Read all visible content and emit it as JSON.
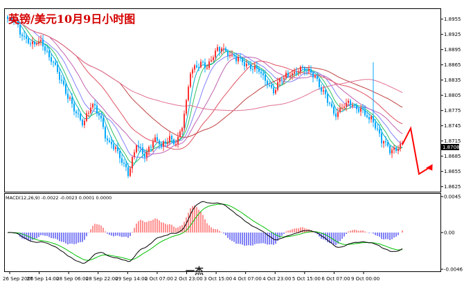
{
  "chart_data": [
    {
      "type": "candlestick",
      "title": "英镑/美元10月9日小时图",
      "price_axis": {
        "ticks": [
          "1.8955",
          "1.8925",
          "1.8895",
          "1.8865",
          "1.8835",
          "1.8805",
          "1.8775",
          "1.8745",
          "1.8715",
          "1.8685",
          "1.8655",
          "1.8625"
        ],
        "current_price": "1.8708",
        "ylim": [
          1.8615,
          1.8975
        ]
      },
      "time_axis": {
        "ticks": [
          "26 Sep 2006",
          "27 Sep 14:00",
          "28 Sep 06:00",
          "28 Sep 22:00",
          "29 Sep 14:00",
          "2 Oct 07:00",
          "2 Oct 23:00",
          "3 Oct 15:00",
          "4 Oct 07:00",
          "4 Oct 23:00",
          "5 Oct 15:00",
          "6 Oct 07:00",
          "9 Oct 00:00"
        ]
      },
      "price_path": [
        [
          0,
          1.8955
        ],
        [
          4,
          1.8945
        ],
        [
          8,
          1.892
        ],
        [
          12,
          1.89
        ],
        [
          16,
          1.8915
        ],
        [
          20,
          1.888
        ],
        [
          24,
          1.885
        ],
        [
          28,
          1.8815
        ],
        [
          32,
          1.8775
        ],
        [
          36,
          1.875
        ],
        [
          40,
          1.8785
        ],
        [
          44,
          1.8765
        ],
        [
          48,
          1.872
        ],
        [
          52,
          1.8695
        ],
        [
          56,
          1.867
        ],
        [
          58,
          1.8655
        ],
        [
          62,
          1.8705
        ],
        [
          66,
          1.869
        ],
        [
          70,
          1.8715
        ],
        [
          74,
          1.8705
        ],
        [
          78,
          1.8725
        ],
        [
          81,
          1.8705
        ],
        [
          84,
          1.874
        ],
        [
          88,
          1.8855
        ],
        [
          92,
          1.886
        ],
        [
          96,
          1.8865
        ],
        [
          100,
          1.889
        ],
        [
          104,
          1.8895
        ],
        [
          108,
          1.8885
        ],
        [
          112,
          1.887
        ],
        [
          116,
          1.8865
        ],
        [
          120,
          1.8855
        ],
        [
          124,
          1.8835
        ],
        [
          128,
          1.8815
        ],
        [
          132,
          1.8835
        ],
        [
          136,
          1.885
        ],
        [
          140,
          1.8855
        ],
        [
          144,
          1.8855
        ],
        [
          148,
          1.8845
        ],
        [
          150,
          1.882
        ],
        [
          154,
          1.8795
        ],
        [
          158,
          1.877
        ],
        [
          162,
          1.8785
        ],
        [
          166,
          1.879
        ],
        [
          170,
          1.8775
        ],
        [
          174,
          1.8755
        ],
        [
          176,
          1.876
        ],
        [
          180,
          1.8715
        ],
        [
          184,
          1.8695
        ],
        [
          188,
          1.8705
        ],
        [
          190,
          1.8708
        ]
      ],
      "spike": {
        "index": 176,
        "high": 1.887
      },
      "moving_average_colors": [
        "#00b0c0",
        "#30c060",
        "#8080ff",
        "#c060b0",
        "#e05060",
        "#c04040",
        "#e07090"
      ],
      "forecast_arrow": {
        "color": "#ff0000",
        "points": [
          [
            190,
            1.8708
          ],
          [
            194,
            1.874
          ],
          [
            198,
            1.865
          ],
          [
            204,
            1.8665
          ]
        ]
      }
    },
    {
      "type": "macd",
      "label": "MACD(12,26,9) -0.0022 -0.0023 0.0001 0.0000",
      "y_ticks": [
        "0.0045",
        "0.00",
        "-0.0046"
      ],
      "ylim": [
        -0.0052,
        0.0052
      ],
      "histogram_colors": {
        "positive": "#ff2020",
        "negative": "#0000ee"
      },
      "line_colors": {
        "macd": "#000000",
        "signal": "#00c000"
      }
    }
  ],
  "bottom_text": "一杰"
}
